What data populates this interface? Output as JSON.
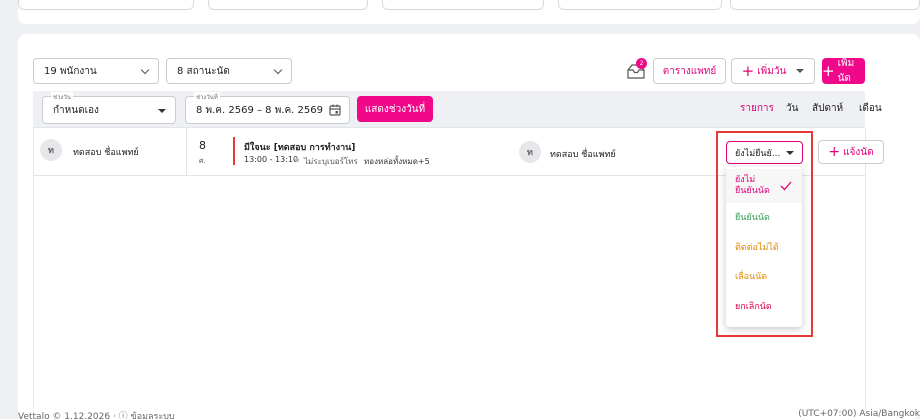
{
  "filters": {
    "staff": "19 พนักงาน",
    "status": "8 สถานะนัด"
  },
  "toolbar": {
    "inbox_badge": "2",
    "doctor_schedule": "ตารางแพทย์",
    "add_day": "เพิ่มวัน",
    "add_appointment": "เพิ่มนัด"
  },
  "range": {
    "period_label": "ช่วงวัน",
    "period_value": "กำหนดเอง",
    "date_label": "ช่วงวันที่",
    "date_value": "8 พ.ค. 2569 – 8 พ.ค. 2569",
    "show_button": "แสดงช่วงวันที่"
  },
  "views": [
    "รายการ",
    "วัน",
    "สัปดาห์",
    "เดือน"
  ],
  "appointment": {
    "doctor_initial": "ท",
    "doctor_name": "ทดสอบ ชื่อแพทย์",
    "day": "8",
    "weekday": "ศ.",
    "title": "มีใจนะ [ทดสอบ การทำงาน]",
    "time": "13:00 - 13:10",
    "phone": "ไม่ระบุเบอร์โทร",
    "extra": "ทองหล่อทั้งหมด+5",
    "patient_initial": "ท",
    "patient_name": "ทดสอบ ชื่อแพทย์",
    "status_value": "ยังไม่ยืนยั...",
    "notify": "แจ้งนัด"
  },
  "status_menu": [
    {
      "label": "ยังไม่ยืนยันนัด",
      "color": "#e0007a",
      "selected": true
    },
    {
      "label": "ยืนยันนัด",
      "color": "#2e9e4f",
      "selected": false
    },
    {
      "label": "ติดต่อไม่ได้",
      "color": "#e08a00",
      "selected": false
    },
    {
      "label": "เลื่อนนัด",
      "color": "#e08a00",
      "selected": false
    },
    {
      "label": "ยกเลิกนัด",
      "color": "#e0004f",
      "selected": false
    }
  ],
  "footer": {
    "left": "Vettalo © 1.12.2026 · ⓘ ข้อมูลระบบ",
    "right": "(UTC+07:00) Asia/Bangkok"
  }
}
